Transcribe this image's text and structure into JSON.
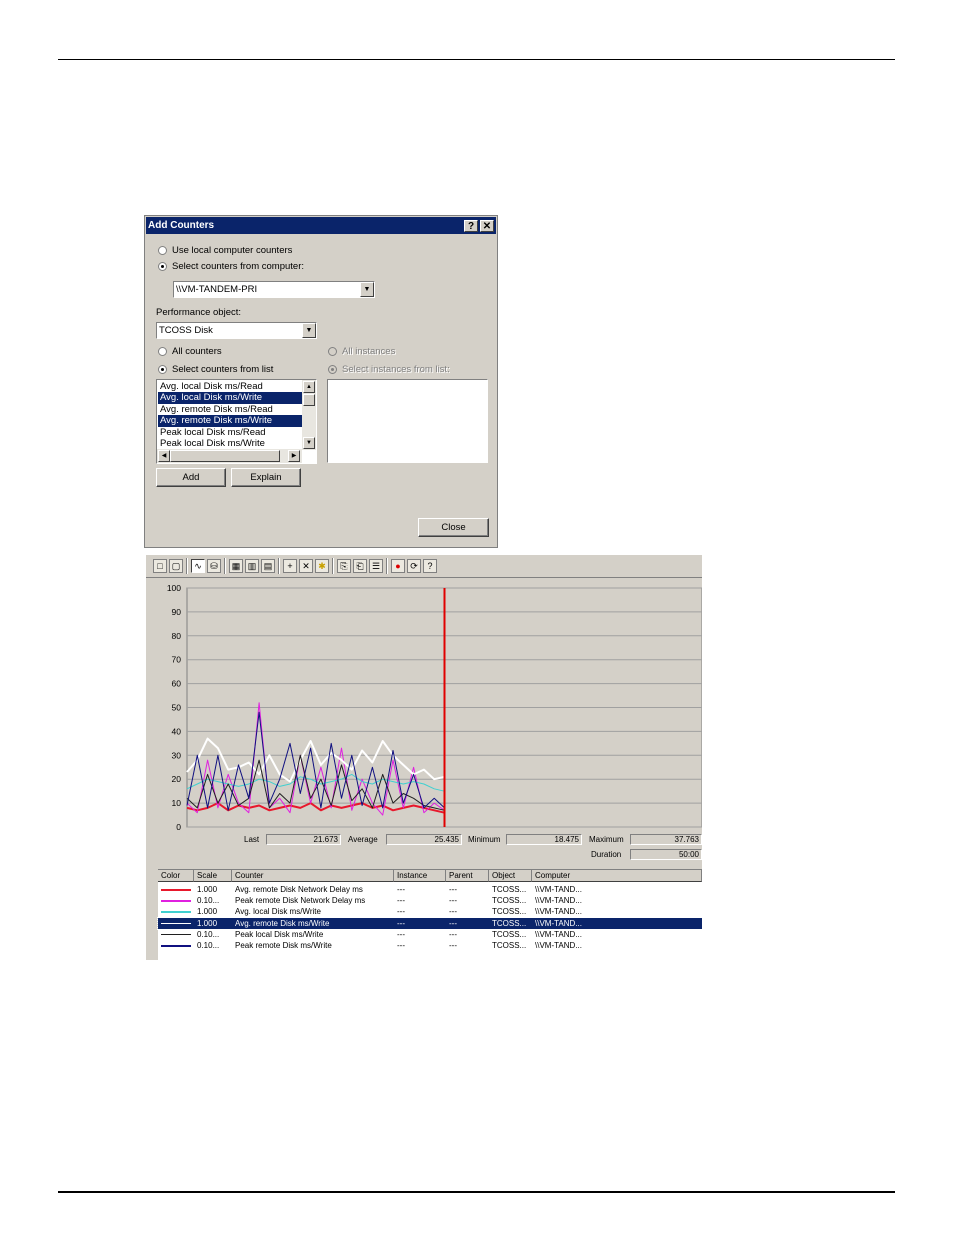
{
  "dialog": {
    "title": "Add Counters",
    "help_glyph": "?",
    "close_glyph": "✕",
    "opt_local": "Use local computer counters",
    "opt_select_computer": "Select counters from computer:",
    "computer_value": "\\\\VM-TANDEM-PRI",
    "perf_object_label": "Performance object:",
    "perf_object_value": "TCOSS Disk",
    "opt_all_counters": "All counters",
    "opt_select_counters": "Select counters from list",
    "opt_all_instances": "All instances",
    "opt_select_instances": "Select instances from list:",
    "counters": [
      {
        "label": "Avg. local Disk ms/Read",
        "selected": false
      },
      {
        "label": "Avg. local Disk ms/Write",
        "selected": true
      },
      {
        "label": "Avg. remote Disk ms/Read",
        "selected": false
      },
      {
        "label": "Avg. remote Disk ms/Write",
        "selected": true
      },
      {
        "label": "Peak local Disk ms/Read",
        "selected": false
      },
      {
        "label": "Peak local Disk ms/Write",
        "selected": false
      }
    ],
    "add_label": "Add",
    "explain_label": "Explain",
    "close_label": "Close"
  },
  "perfmon": {
    "toolbar_icons": [
      "new-counter-set-icon",
      "clear-display-icon",
      "view-current-activity-icon",
      "view-log-data-icon",
      "view-graph-icon",
      "view-histogram-icon",
      "view-report-icon",
      "add-counter-icon",
      "delete-counter-icon",
      "highlight-icon",
      "copy-properties-icon",
      "paste-counter-list-icon",
      "properties-icon",
      "freeze-display-icon",
      "update-data-icon",
      "help-icon"
    ],
    "stats": {
      "last_label": "Last",
      "last_value": "21.673",
      "average_label": "Average",
      "average_value": "25.435",
      "minimum_label": "Minimum",
      "minimum_value": "18.475",
      "maximum_label": "Maximum",
      "maximum_value": "37.763",
      "duration_label": "Duration",
      "duration_value": "50:00"
    },
    "columns": [
      "Color",
      "Scale",
      "Counter",
      "Instance",
      "Parent",
      "Object",
      "Computer"
    ],
    "rows": [
      {
        "color": "#e8182c",
        "scale": "1.000",
        "counter": "Avg. remote Disk Network Delay ms",
        "instance": "---",
        "parent": "---",
        "object": "TCOSS...",
        "computer": "\\\\VM-TAND...",
        "selected": false
      },
      {
        "color": "#e020e0",
        "scale": "0.10...",
        "counter": "Peak remote Disk Network Delay ms",
        "instance": "---",
        "parent": "---",
        "object": "TCOSS...",
        "computer": "\\\\VM-TAND...",
        "selected": false
      },
      {
        "color": "#40d0d0",
        "scale": "1.000",
        "counter": "Avg. local Disk ms/Write",
        "instance": "---",
        "parent": "---",
        "object": "TCOSS...",
        "computer": "\\\\VM-TAND...",
        "selected": false
      },
      {
        "color": "#ffffff",
        "scale": "1.000",
        "counter": "Avg. remote Disk ms/Write",
        "instance": "---",
        "parent": "---",
        "object": "TCOSS...",
        "computer": "\\\\VM-TAND...",
        "selected": true
      },
      {
        "color": "#202020",
        "scale": "0.10...",
        "counter": "Peak local Disk ms/Write",
        "instance": "---",
        "parent": "---",
        "object": "TCOSS...",
        "computer": "\\\\VM-TAND...",
        "selected": false
      },
      {
        "color": "#101080",
        "scale": "0.10...",
        "counter": "Peak remote Disk ms/Write",
        "instance": "---",
        "parent": "---",
        "object": "TCOSS...",
        "computer": "\\\\VM-TAND...",
        "selected": false
      }
    ]
  },
  "chart_data": {
    "type": "line",
    "ylim": [
      0,
      100
    ],
    "y_ticks": [
      0,
      10,
      20,
      30,
      40,
      50,
      60,
      70,
      80,
      90,
      100
    ],
    "xlim": [
      0,
      100
    ],
    "grid": true,
    "cursor_x": 50,
    "series": [
      {
        "color": "#e8182c",
        "x": [
          0,
          2,
          4,
          6,
          8,
          10,
          12,
          14,
          16,
          18,
          20,
          22,
          24,
          26,
          28,
          30,
          32,
          34,
          36,
          38,
          40,
          42,
          44,
          46,
          48,
          50
        ],
        "values": [
          8,
          7,
          8,
          10,
          7,
          9,
          8,
          9,
          7,
          8,
          9,
          8,
          10,
          7,
          9,
          8,
          9,
          10,
          8,
          9,
          7,
          8,
          9,
          8,
          7,
          6
        ]
      },
      {
        "color": "#e020e0",
        "x": [
          0,
          2,
          4,
          6,
          8,
          10,
          12,
          14,
          16,
          18,
          20,
          22,
          24,
          26,
          28,
          30,
          32,
          34,
          36,
          38,
          40,
          42,
          44,
          46,
          48,
          50
        ],
        "values": [
          10,
          6,
          28,
          8,
          22,
          10,
          6,
          52,
          8,
          12,
          6,
          30,
          10,
          25,
          8,
          33,
          7,
          20,
          10,
          5,
          28,
          8,
          25,
          6,
          10,
          7
        ]
      },
      {
        "color": "#40d0d0",
        "x": [
          0,
          2,
          4,
          6,
          8,
          10,
          12,
          14,
          16,
          18,
          20,
          22,
          24,
          26,
          28,
          30,
          32,
          34,
          36,
          38,
          40,
          42,
          44,
          46,
          48,
          50
        ],
        "values": [
          16,
          18,
          20,
          19,
          18,
          17,
          18,
          20,
          19,
          17,
          18,
          21,
          20,
          18,
          19,
          20,
          22,
          19,
          18,
          20,
          19,
          18,
          19,
          18,
          16,
          15
        ]
      },
      {
        "color": "#ffffff",
        "x": [
          0,
          2,
          4,
          6,
          8,
          10,
          12,
          14,
          16,
          18,
          20,
          22,
          24,
          26,
          28,
          30,
          32,
          34,
          36,
          38,
          40,
          42,
          44,
          46,
          48,
          50
        ],
        "values": [
          23,
          28,
          37,
          33,
          24,
          25,
          27,
          22,
          30,
          22,
          19,
          28,
          36,
          26,
          31,
          28,
          24,
          32,
          27,
          36,
          30,
          26,
          22,
          24,
          20,
          21
        ]
      },
      {
        "color": "#202020",
        "x": [
          0,
          2,
          4,
          6,
          8,
          10,
          12,
          14,
          16,
          18,
          20,
          22,
          24,
          26,
          28,
          30,
          32,
          34,
          36,
          38,
          40,
          42,
          44,
          46,
          48,
          50
        ],
        "values": [
          12,
          8,
          22,
          10,
          18,
          9,
          12,
          28,
          8,
          14,
          10,
          30,
          12,
          20,
          9,
          26,
          11,
          16,
          8,
          22,
          10,
          14,
          12,
          9,
          8,
          7
        ]
      },
      {
        "color": "#101080",
        "x": [
          0,
          2,
          4,
          6,
          8,
          10,
          12,
          14,
          16,
          18,
          20,
          22,
          24,
          26,
          28,
          30,
          32,
          34,
          36,
          38,
          40,
          42,
          44,
          46,
          48,
          50
        ],
        "values": [
          9,
          30,
          8,
          30,
          7,
          26,
          12,
          48,
          10,
          20,
          35,
          14,
          33,
          8,
          35,
          12,
          30,
          9,
          25,
          8,
          32,
          10,
          22,
          8,
          12,
          8
        ]
      }
    ]
  }
}
